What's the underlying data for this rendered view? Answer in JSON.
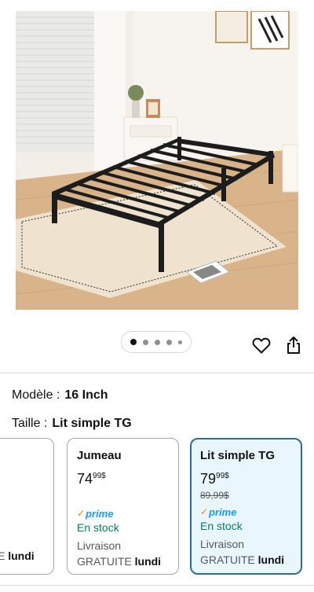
{
  "gallery": {
    "dots_total": 5,
    "active_dot": 1
  },
  "actions": {
    "wishlist_icon": "heart-icon",
    "share_icon": "share-icon"
  },
  "specs": {
    "model_label": "Modèle :",
    "model_value": "16 Inch",
    "size_label": "Taille :",
    "size_value": "Lit simple TG"
  },
  "options": [
    {
      "delivery_day": "lundi",
      "partial_text": "E"
    },
    {
      "title": "Jumeau",
      "price_whole": "74",
      "price_fraction": "99",
      "currency": "$",
      "prime": "prime",
      "stock": "En stock",
      "delivery_line1": "Livraison",
      "delivery_line2_prefix": "GRATUITE",
      "delivery_day": "lundi"
    },
    {
      "title": "Lit simple TG",
      "price_whole": "79",
      "price_fraction": "99",
      "currency": "$",
      "old_price": "89,99$",
      "prime": "prime",
      "stock": "En stock",
      "delivery_line1": "Livraison",
      "delivery_line2_prefix": "GRATUITE",
      "delivery_day": "lundi",
      "selected": true
    }
  ],
  "colors": {
    "selected_border": "#2e6b98",
    "selected_bg": "#eaf6fd",
    "stock_green": "#067d62",
    "prime_blue": "#1a98ff"
  }
}
